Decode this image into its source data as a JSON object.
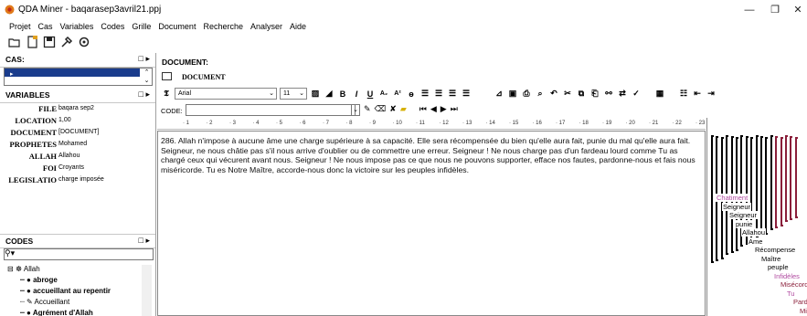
{
  "window": {
    "title": "QDA Miner - baqarasep3avril21.ppj",
    "controls": [
      "—",
      "❐",
      "✕"
    ]
  },
  "menu": [
    "Projet",
    "Cas",
    "Variables",
    "Codes",
    "Grille",
    "Document",
    "Recherche",
    "Analyser",
    "Aide"
  ],
  "toolbar_icons": [
    "open-folder-icon",
    "new-document-icon",
    "save-icon",
    "tools-icon",
    "settings-icon"
  ],
  "left": {
    "cas_header": "CAS:",
    "variables_header": "VARIABLES",
    "variables": [
      {
        "name": "FILE",
        "value": "baqara sep2"
      },
      {
        "name": "LOCATION",
        "value": "1,00"
      },
      {
        "name": "DOCUMENT",
        "value": "[DOCUMENT]"
      },
      {
        "name": "PROPHETES",
        "value": "Mohamed"
      },
      {
        "name": "ALLAH",
        "value": "Allahou"
      },
      {
        "name": "FOI",
        "value": "Croyants"
      },
      {
        "name": "LEGISLATIO",
        "value": "charge imposée"
      }
    ],
    "codes_header": "CODES",
    "codes_tree": [
      {
        "label": "Allah",
        "level": 0,
        "bold": false
      },
      {
        "label": "abroge",
        "level": 1,
        "bold": true
      },
      {
        "label": "accueillant au repentir",
        "level": 1,
        "bold": true
      },
      {
        "label": "Accueillant",
        "level": 1,
        "bold": false
      },
      {
        "label": "Agrément d'Allah",
        "level": 1,
        "bold": true
      }
    ]
  },
  "main": {
    "document_label": "DOCUMENT:",
    "document_tab": "DOCUMENT",
    "font_name": "Arial",
    "font_size": "11",
    "code_label": "CODE:",
    "code_value": "",
    "ruler_marks": [
      "1",
      "2",
      "3",
      "4",
      "5",
      "6",
      "7",
      "8",
      "9",
      "10",
      "11",
      "12",
      "13",
      "14",
      "15",
      "16",
      "17",
      "18",
      "19",
      "20",
      "21",
      "22",
      "23"
    ],
    "text": "286. Allah n'impose à aucune âme une charge supérieure à sa capacité. Elle sera récompensée du bien qu'elle aura fait, punie du mal qu'elle aura fait. Seigneur, ne nous châtie pas s'il nous arrive d'oublier ou de commettre une erreur. Seigneur ! Ne nous charge pas d'un fardeau lourd comme Tu as chargé ceux qui vécurent avant nous. Seigneur ! Ne nous impose pas ce que nous ne pouvons supporter, efface nos fautes, pardonne-nous et fais nous miséricorde. Tu es Notre Maître, accorde-nous donc la victoire sur les peuples infidèles."
  },
  "margin_codes": [
    {
      "label": "Chatiment",
      "color": "#b04aa0"
    },
    {
      "label": "Seigneur",
      "color": "#000000"
    },
    {
      "label": "Seigneur",
      "color": "#000000"
    },
    {
      "label": "punie",
      "color": "#000000"
    },
    {
      "label": "Allahou",
      "color": "#000000"
    },
    {
      "label": "Ame",
      "color": "#000000"
    },
    {
      "label": "Récompense",
      "color": "#000000"
    },
    {
      "label": "Maître",
      "color": "#000000"
    },
    {
      "label": "peuple",
      "color": "#000000"
    },
    {
      "label": "Infidèles",
      "color": "#b04aa0"
    },
    {
      "label": "Misécordie",
      "color": "#8a1f3a"
    },
    {
      "label": "Tu",
      "color": "#b04aa0"
    },
    {
      "label": "Pardon",
      "color": "#8a1f3a"
    },
    {
      "label": "Misé",
      "color": "#8a1f3a"
    }
  ]
}
